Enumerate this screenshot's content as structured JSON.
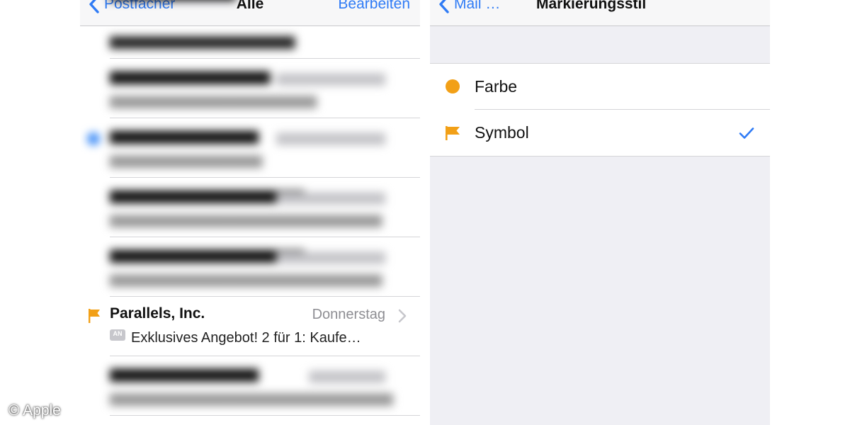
{
  "mail_list": {
    "nav": {
      "back_label": "Postfächer",
      "title": "Alle",
      "action_label": "Bearbeiten"
    },
    "rows": [
      {
        "sender": "",
        "date": "",
        "snippet": "",
        "state": "blurred"
      },
      {
        "sender": "",
        "date": "",
        "snippet": "",
        "state": "blurred"
      },
      {
        "sender": "",
        "date": "",
        "snippet": "",
        "state": "blurred"
      },
      {
        "sender": "",
        "date": "",
        "snippet": "",
        "state": "blurred"
      },
      {
        "sender": "",
        "date": "",
        "snippet": "",
        "state": "blurred"
      },
      {
        "sender": "Parallels, Inc.",
        "date": "Donnerstag",
        "badge": "AN",
        "snippet": "Exklusives Angebot! 2 für 1: Kaufe…",
        "state": "flagged"
      },
      {
        "sender": "",
        "date": "",
        "snippet": "",
        "state": "blurred"
      }
    ]
  },
  "settings": {
    "nav": {
      "back_label": "Mail …",
      "title": "Markierungsstil"
    },
    "options": [
      {
        "label": "Farbe",
        "icon": "orange-dot-icon",
        "selected": false
      },
      {
        "label": "Symbol",
        "icon": "flag-icon",
        "selected": true
      }
    ]
  },
  "colors": {
    "accent_blue": "#2f7bf5",
    "flag_orange": "#f2a017",
    "unread_blue": "#3a8af7",
    "group_bg": "#efeff4"
  },
  "watermark": "© Apple"
}
